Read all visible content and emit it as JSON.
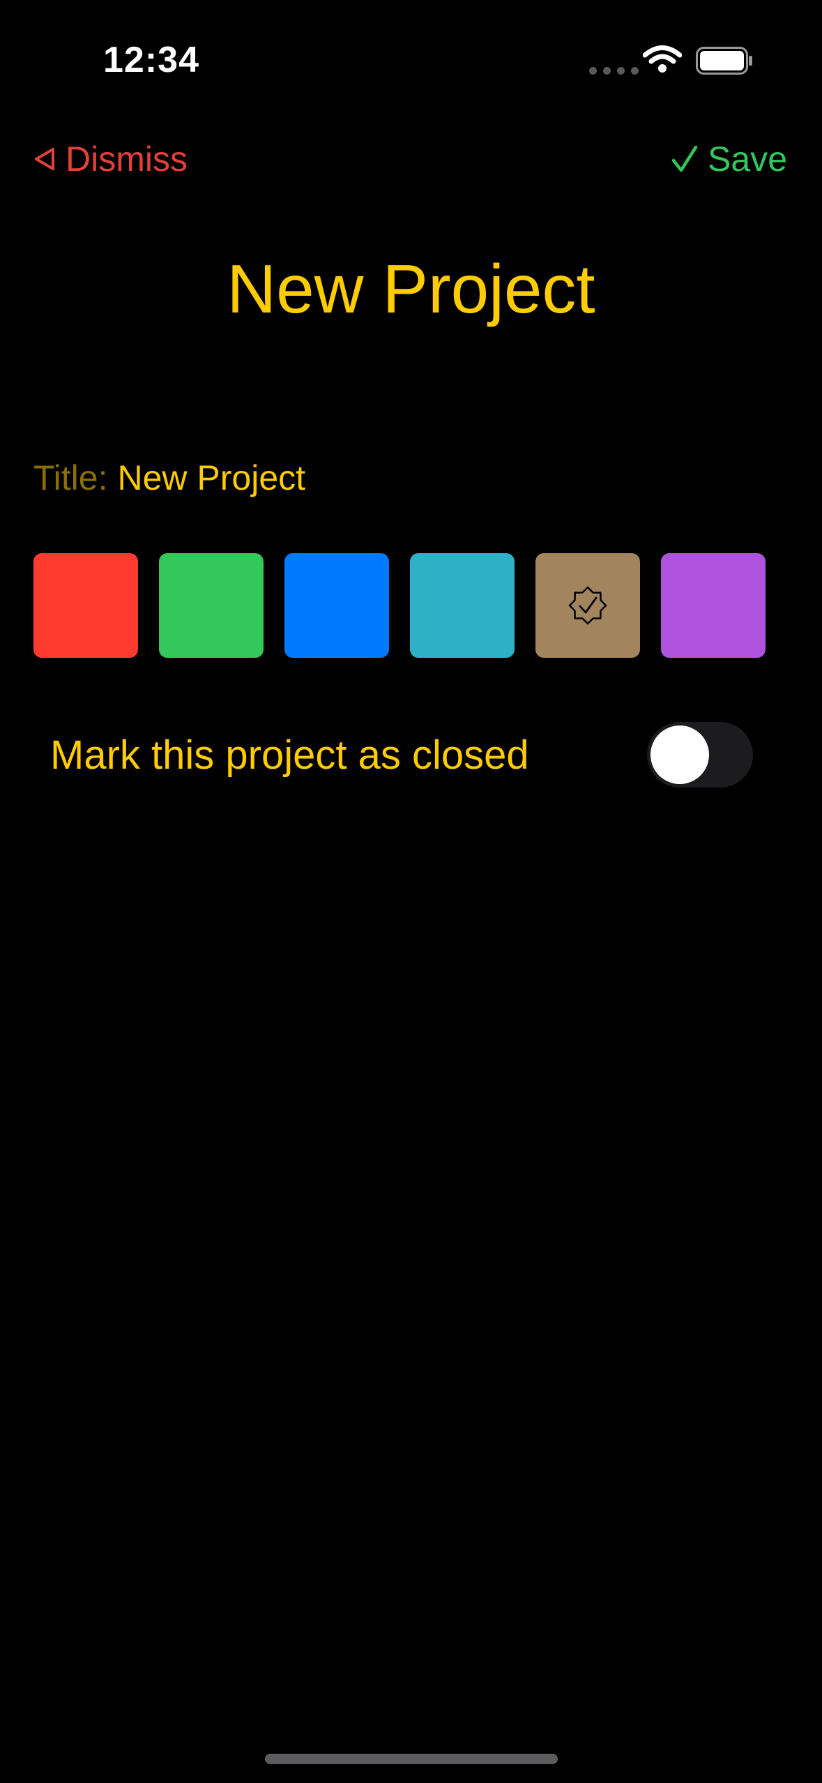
{
  "status_bar": {
    "time": "12:34"
  },
  "nav": {
    "dismiss_label": "Dismiss",
    "dismiss_icon": "arrowtriangle-left-icon",
    "save_label": "Save",
    "save_icon": "checkmark-icon"
  },
  "title": "New Project",
  "form": {
    "title_label": "Title:",
    "title_value": "New Project",
    "title_placeholder": "Title"
  },
  "colors": {
    "options": [
      "#ff3b30",
      "#34c759",
      "#007aff",
      "#30b0c7",
      "#a2845e",
      "#af52de"
    ],
    "selected_index": 4,
    "selected_icon": "checkmark-seal-icon"
  },
  "closed_toggle": {
    "label": "Mark this project as closed",
    "on": false
  },
  "theme": {
    "accent": "#ffcc00",
    "dismiss": "#e2403a",
    "save": "#34c759",
    "background": "#000000"
  }
}
